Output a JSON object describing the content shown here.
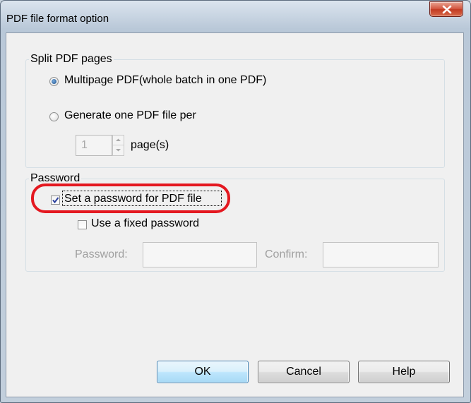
{
  "window": {
    "title": "PDF file format option"
  },
  "split_group": {
    "legend": "Split PDF pages",
    "option_multipage": {
      "label": "Multipage PDF(whole batch in one PDF)",
      "checked": true
    },
    "option_per_page": {
      "label": "Generate one PDF file per",
      "checked": false
    },
    "pages_value": "1",
    "pages_unit": "page(s)"
  },
  "password_group": {
    "legend": "Password",
    "set_password": {
      "label": "Set a password for PDF file",
      "checked": true
    },
    "fixed_password": {
      "label": "Use a fixed password",
      "checked": false
    },
    "password_label": "Password:",
    "password_value": "",
    "confirm_label": "Confirm:",
    "confirm_value": ""
  },
  "buttons": {
    "ok": "OK",
    "cancel": "Cancel",
    "help": "Help"
  },
  "colors": {
    "highlight": "#e41820",
    "accent": "#3c7fb1"
  }
}
